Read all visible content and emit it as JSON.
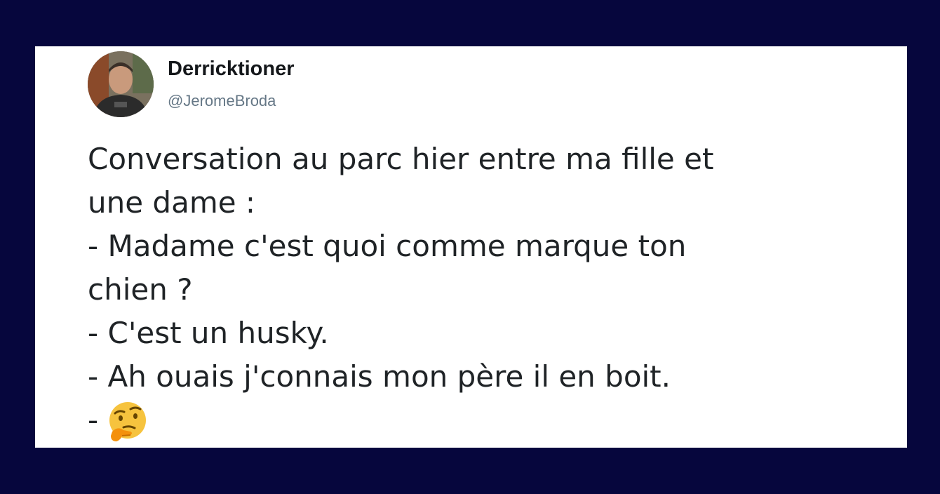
{
  "tweet": {
    "author_name": "Derricktioner",
    "author_handle": "@JeromeBroda",
    "lines": [
      "Conversation au parc hier entre ma fille et",
      "une dame :",
      "- Madame c'est quoi comme marque ton",
      "chien ?",
      "- C'est un husky.",
      "- Ah ouais j'connais mon père il en boit.",
      "-"
    ],
    "emoji": "thinking-face-icon"
  },
  "colors": {
    "background": "#06063d",
    "card": "#ffffff",
    "name": "#14171a",
    "handle": "#657786",
    "text": "#1f2326"
  }
}
